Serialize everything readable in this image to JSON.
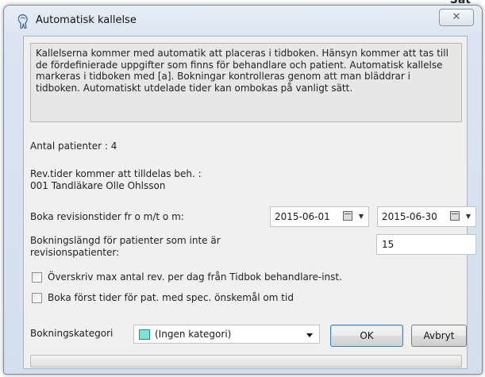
{
  "background_text": "Sat",
  "dialog": {
    "title": "Automatisk kallelse",
    "close_glyph": "✕"
  },
  "info": {
    "text": "Kallelserna kommer med automatik att placeras i tidboken. Hänsyn kommer att tas till de fördefinierade uppgifter som finns för behandlare och patient. Automatisk kallelse markeras i tidboken med [a]. Bokningar kontrolleras genom att man bläddrar i tidboken. Automatiskt utdelade tider kan ombokas på vanligt sätt."
  },
  "patients": {
    "label": "Antal patienter : 4"
  },
  "provider": {
    "line1": "Rev.tider kommer att tilldelas beh. :",
    "line2": "001 Tandläkare Olle Ohlsson"
  },
  "booking_period": {
    "label": "Boka revisionstider fr o m/t o m:",
    "from_date": "2015-06-01",
    "to_date": "2015-06-30"
  },
  "booking_length": {
    "label_line1": "Bokningslängd för patienter som inte är",
    "label_line2": "revisionspatienter:",
    "value": "15"
  },
  "options": {
    "override_label": "Överskriv max antal rev. per dag från Tidbok behandlare-inst.",
    "override_checked": false,
    "special_label": "Boka först tider för pat. med spec. önskemål om tid",
    "special_checked": false
  },
  "category": {
    "label": "Bokningskategori",
    "selected": "(Ingen kategori)",
    "swatch_color": "#7fe0d4"
  },
  "buttons": {
    "ok": "OK",
    "cancel": "Avbryt"
  },
  "progress": {
    "percent": 0
  },
  "colors": {
    "accent_border": "#3c7fb1",
    "progress_fill": "#06b025"
  }
}
